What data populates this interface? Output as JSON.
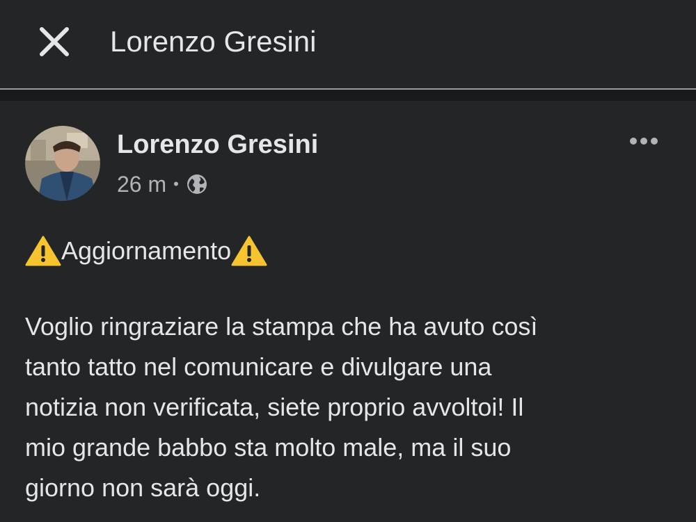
{
  "header": {
    "title": "Lorenzo Gresini",
    "close_icon": "close-icon"
  },
  "post": {
    "author": "Lorenzo Gresini",
    "time": "26 m",
    "separator": "•",
    "privacy_icon": "globe-icon",
    "more_icon": "more-horizontal-icon",
    "headline": "Aggiornamento",
    "body_lines": [
      "Voglio ringraziare la stampa che ha avuto così",
      "tanto tatto nel comunicare e divulgare una",
      "notizia non verificata, siete proprio avvoltoi! Il",
      "mio grande babbo sta molto male, ma il suo",
      "giorno non sarà oggi."
    ]
  },
  "colors": {
    "background": "#242526",
    "separator_band": "#18191a",
    "text_primary": "#e4e6eb",
    "text_secondary": "#b0b3b8",
    "warning": "#f7c32e"
  }
}
